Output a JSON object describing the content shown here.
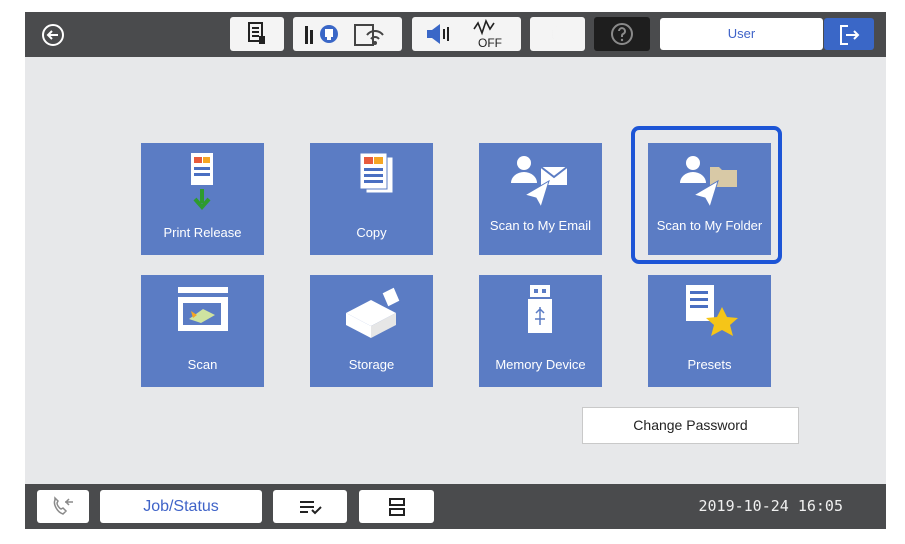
{
  "topbar": {
    "user_label": "User",
    "status_icons": [
      "back-icon",
      "job-info-icon",
      "network-icon",
      "wifi-icon",
      "volume-icon",
      "sleep-timer-off-icon",
      "sleep-icon",
      "help-icon",
      "logout-icon"
    ],
    "sleep_timer_text": "OFF"
  },
  "tiles": [
    {
      "label": "Print Release",
      "icon": "print-release-icon"
    },
    {
      "label": "Copy",
      "icon": "copy-icon"
    },
    {
      "label": "Scan to My Email",
      "icon": "scan-to-email-icon"
    },
    {
      "label": "Scan to My Folder",
      "icon": "scan-to-folder-icon",
      "selected": true
    },
    {
      "label": "Scan",
      "icon": "scan-icon"
    },
    {
      "label": "Storage",
      "icon": "storage-icon"
    },
    {
      "label": "Memory Device",
      "icon": "memory-device-icon"
    },
    {
      "label": "Presets",
      "icon": "presets-icon"
    }
  ],
  "change_password_label": "Change Password",
  "bottombar": {
    "job_status_label": "Job/Status",
    "datetime": "2019-10-24 16:05",
    "icons": [
      "fax-icon",
      "job-queue-icon",
      "stop-icon"
    ]
  },
  "colors": {
    "tile": "#5b7cc4",
    "highlight": "#1d55d6",
    "bar": "#4a4b4d",
    "logout": "#3a67c7",
    "accent_text": "#3f63c8"
  }
}
